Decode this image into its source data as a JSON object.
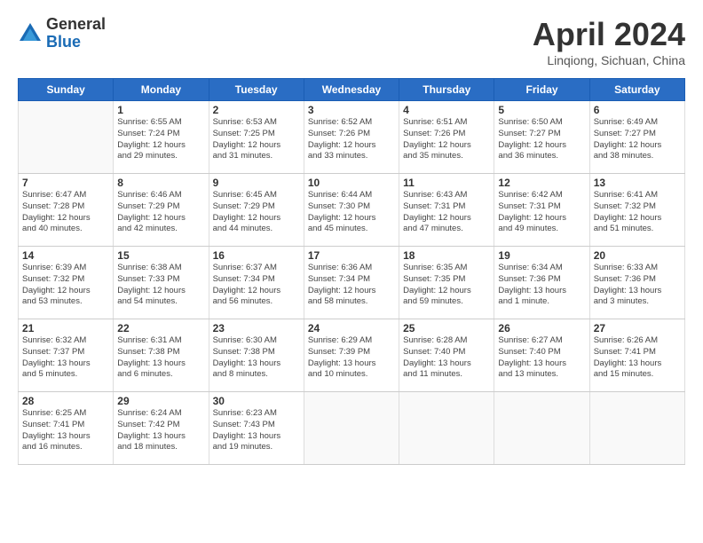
{
  "logo": {
    "general": "General",
    "blue": "Blue"
  },
  "title": "April 2024",
  "subtitle": "Linqiong, Sichuan, China",
  "headers": [
    "Sunday",
    "Monday",
    "Tuesday",
    "Wednesday",
    "Thursday",
    "Friday",
    "Saturday"
  ],
  "weeks": [
    [
      {
        "day": "",
        "text": ""
      },
      {
        "day": "1",
        "text": "Sunrise: 6:55 AM\nSunset: 7:24 PM\nDaylight: 12 hours\nand 29 minutes."
      },
      {
        "day": "2",
        "text": "Sunrise: 6:53 AM\nSunset: 7:25 PM\nDaylight: 12 hours\nand 31 minutes."
      },
      {
        "day": "3",
        "text": "Sunrise: 6:52 AM\nSunset: 7:26 PM\nDaylight: 12 hours\nand 33 minutes."
      },
      {
        "day": "4",
        "text": "Sunrise: 6:51 AM\nSunset: 7:26 PM\nDaylight: 12 hours\nand 35 minutes."
      },
      {
        "day": "5",
        "text": "Sunrise: 6:50 AM\nSunset: 7:27 PM\nDaylight: 12 hours\nand 36 minutes."
      },
      {
        "day": "6",
        "text": "Sunrise: 6:49 AM\nSunset: 7:27 PM\nDaylight: 12 hours\nand 38 minutes."
      }
    ],
    [
      {
        "day": "7",
        "text": "Sunrise: 6:47 AM\nSunset: 7:28 PM\nDaylight: 12 hours\nand 40 minutes."
      },
      {
        "day": "8",
        "text": "Sunrise: 6:46 AM\nSunset: 7:29 PM\nDaylight: 12 hours\nand 42 minutes."
      },
      {
        "day": "9",
        "text": "Sunrise: 6:45 AM\nSunset: 7:29 PM\nDaylight: 12 hours\nand 44 minutes."
      },
      {
        "day": "10",
        "text": "Sunrise: 6:44 AM\nSunset: 7:30 PM\nDaylight: 12 hours\nand 45 minutes."
      },
      {
        "day": "11",
        "text": "Sunrise: 6:43 AM\nSunset: 7:31 PM\nDaylight: 12 hours\nand 47 minutes."
      },
      {
        "day": "12",
        "text": "Sunrise: 6:42 AM\nSunset: 7:31 PM\nDaylight: 12 hours\nand 49 minutes."
      },
      {
        "day": "13",
        "text": "Sunrise: 6:41 AM\nSunset: 7:32 PM\nDaylight: 12 hours\nand 51 minutes."
      }
    ],
    [
      {
        "day": "14",
        "text": "Sunrise: 6:39 AM\nSunset: 7:32 PM\nDaylight: 12 hours\nand 53 minutes."
      },
      {
        "day": "15",
        "text": "Sunrise: 6:38 AM\nSunset: 7:33 PM\nDaylight: 12 hours\nand 54 minutes."
      },
      {
        "day": "16",
        "text": "Sunrise: 6:37 AM\nSunset: 7:34 PM\nDaylight: 12 hours\nand 56 minutes."
      },
      {
        "day": "17",
        "text": "Sunrise: 6:36 AM\nSunset: 7:34 PM\nDaylight: 12 hours\nand 58 minutes."
      },
      {
        "day": "18",
        "text": "Sunrise: 6:35 AM\nSunset: 7:35 PM\nDaylight: 12 hours\nand 59 minutes."
      },
      {
        "day": "19",
        "text": "Sunrise: 6:34 AM\nSunset: 7:36 PM\nDaylight: 13 hours\nand 1 minute."
      },
      {
        "day": "20",
        "text": "Sunrise: 6:33 AM\nSunset: 7:36 PM\nDaylight: 13 hours\nand 3 minutes."
      }
    ],
    [
      {
        "day": "21",
        "text": "Sunrise: 6:32 AM\nSunset: 7:37 PM\nDaylight: 13 hours\nand 5 minutes."
      },
      {
        "day": "22",
        "text": "Sunrise: 6:31 AM\nSunset: 7:38 PM\nDaylight: 13 hours\nand 6 minutes."
      },
      {
        "day": "23",
        "text": "Sunrise: 6:30 AM\nSunset: 7:38 PM\nDaylight: 13 hours\nand 8 minutes."
      },
      {
        "day": "24",
        "text": "Sunrise: 6:29 AM\nSunset: 7:39 PM\nDaylight: 13 hours\nand 10 minutes."
      },
      {
        "day": "25",
        "text": "Sunrise: 6:28 AM\nSunset: 7:40 PM\nDaylight: 13 hours\nand 11 minutes."
      },
      {
        "day": "26",
        "text": "Sunrise: 6:27 AM\nSunset: 7:40 PM\nDaylight: 13 hours\nand 13 minutes."
      },
      {
        "day": "27",
        "text": "Sunrise: 6:26 AM\nSunset: 7:41 PM\nDaylight: 13 hours\nand 15 minutes."
      }
    ],
    [
      {
        "day": "28",
        "text": "Sunrise: 6:25 AM\nSunset: 7:41 PM\nDaylight: 13 hours\nand 16 minutes."
      },
      {
        "day": "29",
        "text": "Sunrise: 6:24 AM\nSunset: 7:42 PM\nDaylight: 13 hours\nand 18 minutes."
      },
      {
        "day": "30",
        "text": "Sunrise: 6:23 AM\nSunset: 7:43 PM\nDaylight: 13 hours\nand 19 minutes."
      },
      {
        "day": "",
        "text": ""
      },
      {
        "day": "",
        "text": ""
      },
      {
        "day": "",
        "text": ""
      },
      {
        "day": "",
        "text": ""
      }
    ]
  ]
}
